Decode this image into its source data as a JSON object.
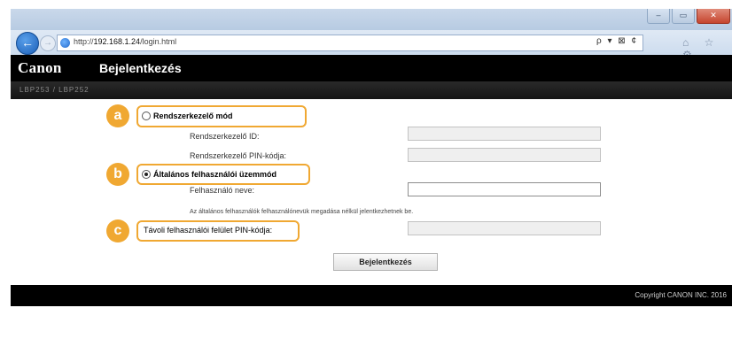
{
  "browser": {
    "url_prefix": "http://",
    "url_host": "192.168.1.24",
    "url_path": "/login.html",
    "addr_tools": "ρ ▾ ⊠ ¢",
    "chrome_icons": "⌂ ☆ ⚙",
    "window_buttons": [
      "–",
      "▭",
      "✕"
    ]
  },
  "header": {
    "brand": "Canon",
    "title": "Bejelentkezés",
    "device_name": "LBP253 / LBP252"
  },
  "form": {
    "admin_mode_label": "Rendszerkezelő mód",
    "admin_id_label": "Rendszerkezelő ID:",
    "admin_pin_label": "Rendszerkezelő PIN-kódja:",
    "general_mode_label": "Általános felhasználói üzemmód",
    "username_label": "Felhasználó neve:",
    "username_hint": "Az általános felhasználók felhasználónevük megadása nélkül jelentkezhetnek be.",
    "remote_pin_label": "Távoli felhasználói felület PIN-kódja:",
    "login_button": "Bejelentkezés",
    "selected_mode": "general"
  },
  "callouts": [
    "a",
    "b",
    "c"
  ],
  "footer": {
    "copyright": "Copyright CANON INC. 2016"
  },
  "colors": {
    "callout": "#f0a832",
    "header_bg": "#000000"
  }
}
